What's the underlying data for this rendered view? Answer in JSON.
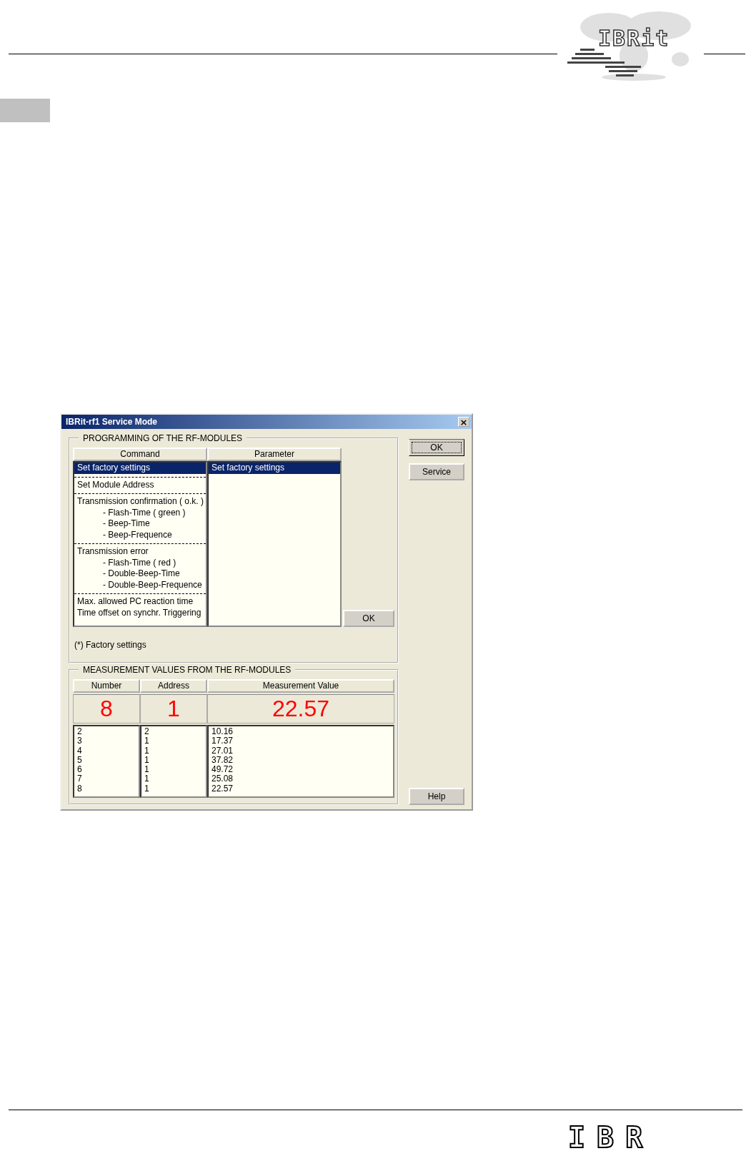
{
  "header": {
    "logo": "IBRit"
  },
  "dialog": {
    "title": "IBRit-rf1 Service Mode",
    "programming": {
      "title": "PROGRAMMING OF THE RF-MODULES",
      "columns": [
        "Command",
        "Parameter"
      ],
      "commands": [
        {
          "label": "Set factory settings",
          "selected": true
        },
        {
          "label": "Set Module Address",
          "selected": false
        },
        {
          "label": "Transmission confirmation ( o.k. )",
          "selected": false,
          "children": [
            {
              "label": "- Flash-Time ( green )"
            },
            {
              "label": "- Beep-Time"
            },
            {
              "label": "- Beep-Frequence"
            }
          ]
        },
        {
          "label": "Transmission error",
          "selected": false,
          "children": [
            {
              "label": "- Flash-Time ( red )"
            },
            {
              "label": "- Double-Beep-Time"
            },
            {
              "label": "- Double-Beep-Frequence"
            }
          ]
        },
        {
          "label": "Max. allowed PC reaction time",
          "selected": false,
          "children": [
            {
              "label": "Time offset on synchr. Triggering",
              "kind": "plain"
            }
          ]
        }
      ],
      "parameters": [
        {
          "label": "Set factory settings",
          "selected": true
        }
      ],
      "ok_button": "OK",
      "note": "(*) Factory settings"
    },
    "measurements": {
      "title": "MEASUREMENT VALUES FROM THE RF-MODULES",
      "columns": [
        "Number",
        "Address",
        "Measurement Value"
      ],
      "current": {
        "number": "8",
        "address": "1",
        "value": "22.57"
      },
      "rows": [
        {
          "number": "2",
          "address": "2",
          "value": "10.16"
        },
        {
          "number": "3",
          "address": "1",
          "value": "17.37"
        },
        {
          "number": "4",
          "address": "1",
          "value": "27.01"
        },
        {
          "number": "5",
          "address": "1",
          "value": "37.82"
        },
        {
          "number": "6",
          "address": "1",
          "value": "49.72"
        },
        {
          "number": "7",
          "address": "1",
          "value": "25.08"
        },
        {
          "number": "8",
          "address": "1",
          "value": "22.57"
        }
      ]
    },
    "buttons": [
      "OK",
      "Service",
      "Help"
    ],
    "close": "×"
  },
  "footer": {
    "logo": "IBR"
  }
}
